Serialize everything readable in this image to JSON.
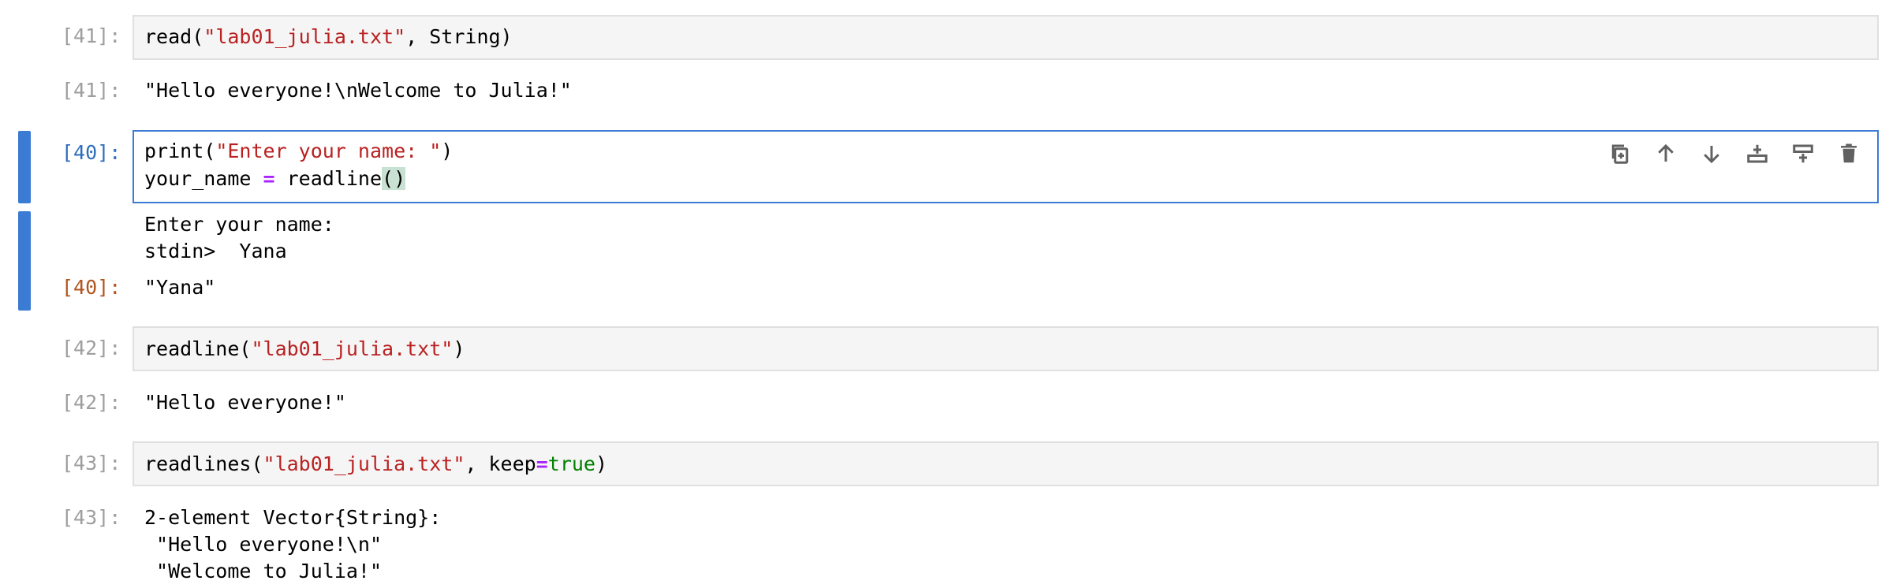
{
  "cells": [
    {
      "prompt_in": "[41]:",
      "code": [
        [
          {
            "t": "read(",
            "c": "plain"
          },
          {
            "t": "\"lab01_julia.txt\"",
            "c": "str"
          },
          {
            "t": ", String)",
            "c": "plain"
          }
        ]
      ],
      "prompt_out": "[41]:",
      "output": [
        "\"Hello everyone!\\nWelcome to Julia!\""
      ]
    },
    {
      "prompt_in": "[40]:",
      "code": [
        [
          {
            "t": "print(",
            "c": "plain"
          },
          {
            "t": "\"Enter your name: \"",
            "c": "str"
          },
          {
            "t": ")",
            "c": "plain"
          }
        ],
        [
          {
            "t": "your_name ",
            "c": "plain"
          },
          {
            "t": "=",
            "c": "op"
          },
          {
            "t": " readline",
            "c": "plain"
          },
          {
            "t": "()",
            "c": "bracket"
          }
        ]
      ],
      "stream_output": [
        "Enter your name:",
        "stdin>  Yana"
      ],
      "prompt_out": "[40]:",
      "output": [
        "\"Yana\""
      ]
    },
    {
      "prompt_in": "[42]:",
      "code": [
        [
          {
            "t": "readline(",
            "c": "plain"
          },
          {
            "t": "\"lab01_julia.txt\"",
            "c": "str"
          },
          {
            "t": ")",
            "c": "plain"
          }
        ]
      ],
      "prompt_out": "[42]:",
      "output": [
        "\"Hello everyone!\""
      ]
    },
    {
      "prompt_in": "[43]:",
      "code": [
        [
          {
            "t": "readlines(",
            "c": "plain"
          },
          {
            "t": "\"lab01_julia.txt\"",
            "c": "str"
          },
          {
            "t": ", keep",
            "c": "plain"
          },
          {
            "t": "=",
            "c": "op"
          },
          {
            "t": "true",
            "c": "kw"
          },
          {
            "t": ")",
            "c": "plain"
          }
        ]
      ],
      "prompt_out": "[43]:",
      "output": [
        "2-element Vector{String}:",
        " \"Hello everyone!\\n\"",
        " \"Welcome to Julia!\""
      ]
    }
  ],
  "toolbar": {
    "icons": [
      "duplicate-icon",
      "move-up-icon",
      "move-down-icon",
      "insert-above-icon",
      "insert-below-icon",
      "delete-icon"
    ]
  },
  "colors": {
    "active_border": "#3b7bd4",
    "string": "#ba2121",
    "operator": "#aa22ff",
    "keyword": "#008000",
    "prompt_inactive": "#9e9e9e",
    "prompt_in_active": "#2f6ebd",
    "prompt_out_active": "#b3541e"
  }
}
